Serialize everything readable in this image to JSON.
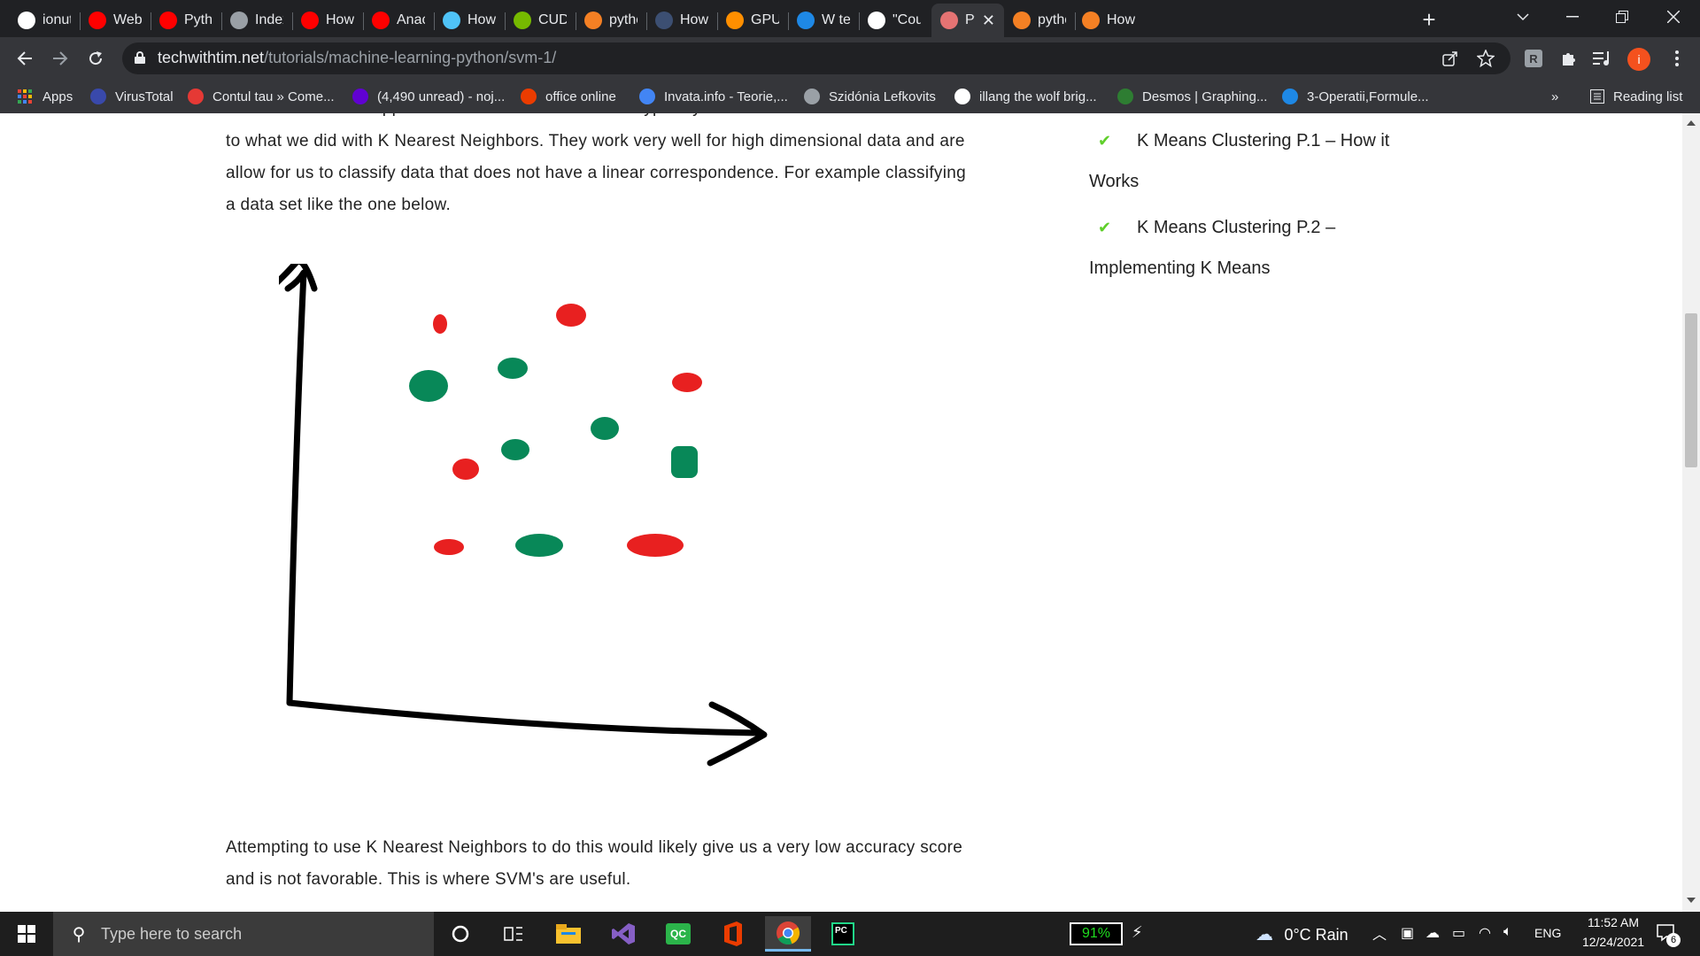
{
  "tabs": [
    {
      "label": "ionutn",
      "icon": "github-icon",
      "color": "#ffffff"
    },
    {
      "label": "Web Sc",
      "icon": "youtube-icon",
      "color": "#ff0000"
    },
    {
      "label": "Python",
      "icon": "youtube-icon",
      "color": "#ff0000"
    },
    {
      "label": "Index o",
      "icon": "globe-icon",
      "color": "#9aa0a6"
    },
    {
      "label": "How to",
      "icon": "youtube-icon",
      "color": "#ff0000"
    },
    {
      "label": "Anacon",
      "icon": "youtube-icon",
      "color": "#ff0000"
    },
    {
      "label": "How to",
      "icon": "eye-icon",
      "color": "#4fc3f7"
    },
    {
      "label": "CUDA T",
      "icon": "nvidia-icon",
      "color": "#76b900"
    },
    {
      "label": "python",
      "icon": "stackoverflow-icon",
      "color": "#f48024"
    },
    {
      "label": "How to",
      "icon": "tds-icon",
      "color": "#3c4f72"
    },
    {
      "label": "GPU su",
      "icon": "tensorflow-icon",
      "color": "#ff8f00"
    },
    {
      "label": "W tens",
      "icon": "circle-icon",
      "color": "#1e88e5"
    },
    {
      "label": "\"Could",
      "icon": "github-icon",
      "color": "#ffffff"
    },
    {
      "label": "Pyt",
      "icon": "techwithtim-icon",
      "color": "#e57373",
      "active": true
    },
    {
      "label": "python",
      "icon": "stackoverflow-icon",
      "color": "#f48024"
    },
    {
      "label": "How to",
      "icon": "stackoverflow-icon",
      "color": "#f48024"
    }
  ],
  "toolbar": {
    "url_host": "techwithtim.net",
    "url_path": "/tutorials/machine-learning-python/svm-1/",
    "profile_initial": "i",
    "extension_initial": "R"
  },
  "bookmarks": [
    {
      "label": "Apps",
      "icon": "apps-grid-icon",
      "color": "#e8eaed"
    },
    {
      "label": "VirusTotal",
      "icon": "virustotal-icon",
      "color": "#3949ab"
    },
    {
      "label": "Contul tau » Come...",
      "icon": "emag-icon",
      "color": "#e53935"
    },
    {
      "label": "(4,490 unread) - noj...",
      "icon": "yahoo-mail-icon",
      "color": "#6001d2"
    },
    {
      "label": "office online",
      "icon": "office-icon",
      "color": "#eb3c00"
    },
    {
      "label": "Invata.info - Teorie,...",
      "icon": "google-g-icon",
      "color": "#4285f4"
    },
    {
      "label": "Szidónia Lefkovits",
      "icon": "globe-icon",
      "color": "#9aa0a6"
    },
    {
      "label": "illang the wolf brig...",
      "icon": "google-g-icon",
      "color": "#ffffff"
    },
    {
      "label": "Desmos | Graphing...",
      "icon": "desmos-icon",
      "color": "#2e7d32"
    },
    {
      "label": "3-Operatii,Formule...",
      "icon": "s-icon",
      "color": "#1e88e5"
    }
  ],
  "reading_list": "Reading list",
  "article": {
    "cut_line": "SVM stands for a support vector machine. SVM's are typically used for classification tasks similar",
    "para1_line1": "to what we did with K Nearest Neighbors. They work very well for high dimensional data and are",
    "para1_line2": "allow for us to classify data that does not have a linear correspondence. For example classifying",
    "para1_line3": "a data set like the one below.",
    "para2_line1": "Attempting to use K Nearest Neighbors to do this would likely give us a very low accuracy score",
    "para2_line2": "and is not favorable. This is where SVM's are useful."
  },
  "figure": {
    "red_color": "#e82020",
    "green_color": "#088858",
    "axis_color": "#000000"
  },
  "sidebar": {
    "item1_line1": "K Means Clustering P.1 – How it",
    "item1_line2": "Works",
    "item2_line1": "K Means Clustering P.2 –",
    "item2_line2": "Implementing K Means"
  },
  "taskbar": {
    "search_placeholder": "Type here to search",
    "battery": "91%",
    "weather": "0°C  Rain",
    "language": "ENG",
    "time": "11:52 AM",
    "date": "12/24/2021",
    "notifications": "6"
  }
}
